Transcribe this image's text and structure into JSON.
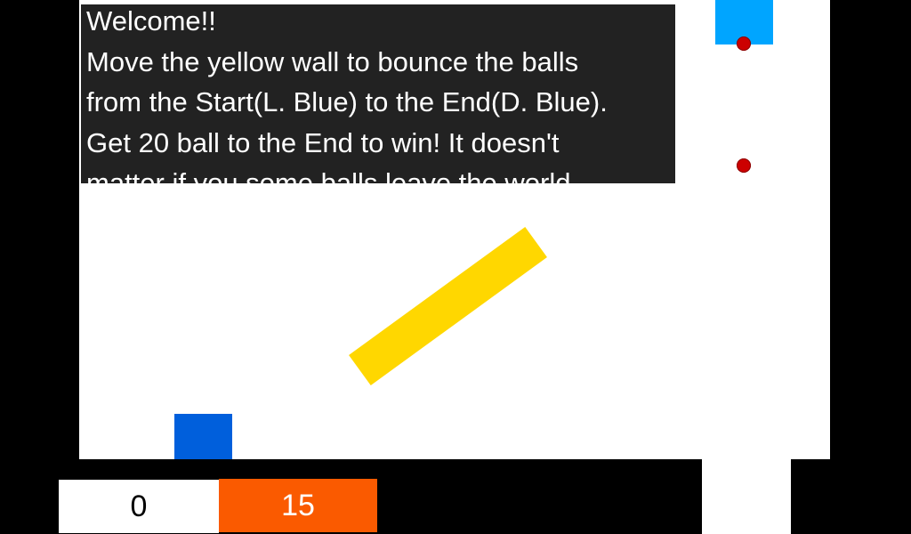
{
  "dialog": {
    "lines": [
      "Welcome!!",
      "Move the yellow wall to bounce the balls",
      "from the Start(L. Blue) to the End(D. Blue).",
      "Get 20 ball to the End to win! It doesn't",
      "matter if you some balls leave the world."
    ]
  },
  "hud": {
    "score": "0",
    "target": "15"
  },
  "colors": {
    "background": "#000000",
    "playfield": "#ffffff",
    "dialog_bg": "#222222",
    "start": "#00a5ff",
    "end": "#005fdc",
    "wall": "#ffd700",
    "ball": "#cc0000",
    "target_box": "#fa5a00"
  }
}
